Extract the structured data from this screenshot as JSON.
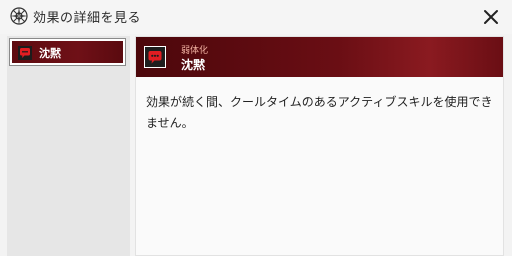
{
  "window": {
    "title": "効果の詳細を見る",
    "title_icon": "compass-emblem-icon",
    "close_icon": "close-icon"
  },
  "sidebar": {
    "items": [
      {
        "label": "沈黙",
        "icon": "speech-bubble-icon",
        "selected": true
      }
    ]
  },
  "effect": {
    "category": "弱体化",
    "name": "沈黙",
    "icon": "speech-bubble-icon",
    "description": "効果が続く間、クールタイムのあるアクティブスキルを使用できません。"
  },
  "colors": {
    "accent_dark": "#5e0b10",
    "accent": "#6f1017",
    "icon_red": "#e21d22",
    "category_text": "#f0b0a0"
  }
}
